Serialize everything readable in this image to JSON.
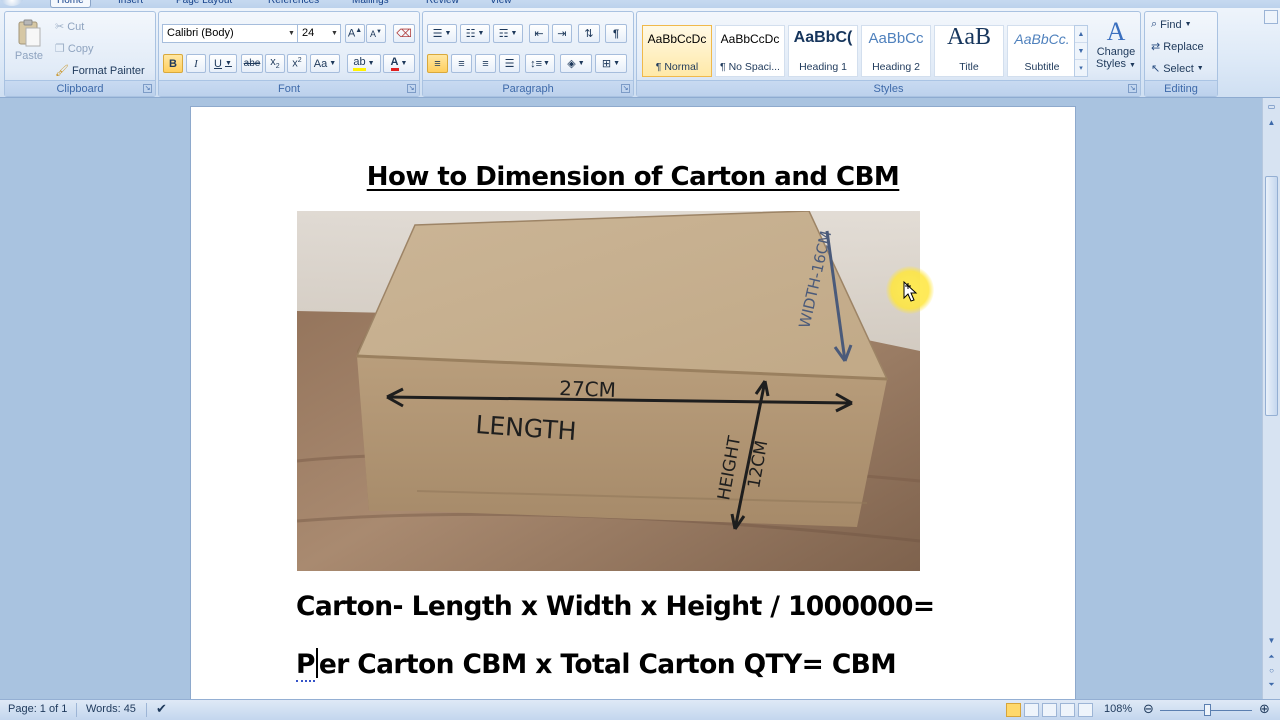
{
  "tabs": [
    "Home",
    "Insert",
    "Page Layout",
    "References",
    "Mailings",
    "Review",
    "View"
  ],
  "clipboard": {
    "paste": "Paste",
    "cut": "Cut",
    "copy": "Copy",
    "format_painter": "Format Painter",
    "label": "Clipboard"
  },
  "font": {
    "family": "Calibri (Body)",
    "size": "24",
    "label": "Font"
  },
  "paragraph": {
    "label": "Paragraph"
  },
  "styles": {
    "label": "Styles",
    "items": [
      {
        "sample": "AaBbCcDc",
        "name": "¶ Normal"
      },
      {
        "sample": "AaBbCcDc",
        "name": "¶ No Spaci..."
      },
      {
        "sample": "AaBbC(",
        "name": "Heading 1"
      },
      {
        "sample": "AaBbCc",
        "name": "Heading 2"
      },
      {
        "sample": "AaB",
        "name": "Title"
      },
      {
        "sample": "AaBbCc.",
        "name": "Subtitle"
      }
    ],
    "change_styles": [
      "Change",
      "Styles"
    ]
  },
  "editing": {
    "label": "Editing",
    "find": "Find",
    "replace": "Replace",
    "select": "Select"
  },
  "document": {
    "title": "How to Dimension of Carton and CBM",
    "line1": "Carton- Length x Width x Height / 1000000=",
    "line2_first_char": "P",
    "line2_second_char": "e",
    "line2_rest": "r Carton CBM x Total Carton QTY= CBM",
    "photo_labels": {
      "length_measure": "27CM",
      "length_word": "LENGTH",
      "height_word": "HEIGHT",
      "height_measure": "12CM",
      "width_text": "WIDTH-16CM"
    }
  },
  "status": {
    "page": "Page: 1 of 1",
    "words": "Words: 45",
    "zoom": "108%"
  },
  "colors": {
    "ribbon_bg": "#dde9f7",
    "doc_bg": "#a9c3e0",
    "selected_style": "#ffe9a8",
    "cursor_highlight": "#ffe63c"
  }
}
